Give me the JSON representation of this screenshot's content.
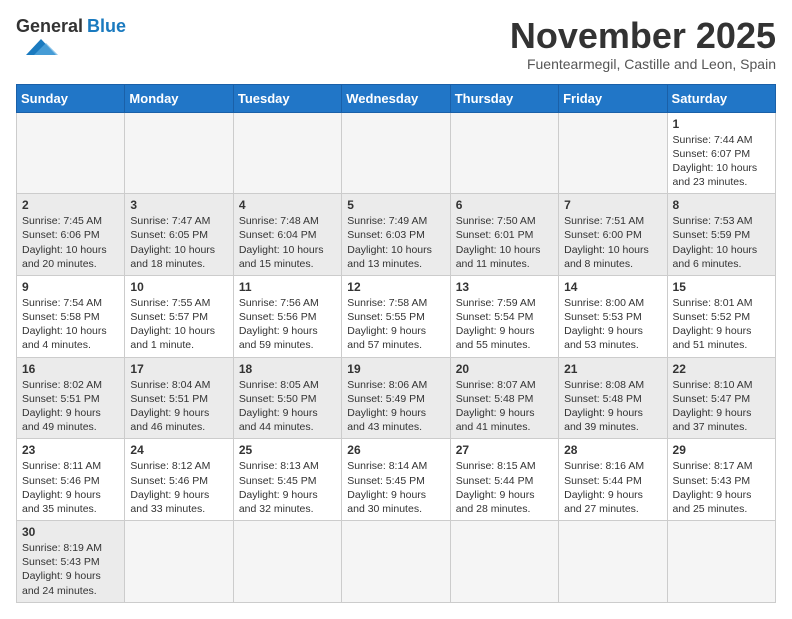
{
  "header": {
    "logo_general": "General",
    "logo_blue": "Blue",
    "month_title": "November 2025",
    "location": "Fuentearmegil, Castille and Leon, Spain"
  },
  "weekdays": [
    "Sunday",
    "Monday",
    "Tuesday",
    "Wednesday",
    "Thursday",
    "Friday",
    "Saturday"
  ],
  "weeks": [
    [
      {
        "day": "",
        "info": ""
      },
      {
        "day": "",
        "info": ""
      },
      {
        "day": "",
        "info": ""
      },
      {
        "day": "",
        "info": ""
      },
      {
        "day": "",
        "info": ""
      },
      {
        "day": "",
        "info": ""
      },
      {
        "day": "1",
        "info": "Sunrise: 7:44 AM\nSunset: 6:07 PM\nDaylight: 10 hours and 23 minutes."
      }
    ],
    [
      {
        "day": "2",
        "info": "Sunrise: 7:45 AM\nSunset: 6:06 PM\nDaylight: 10 hours and 20 minutes."
      },
      {
        "day": "3",
        "info": "Sunrise: 7:47 AM\nSunset: 6:05 PM\nDaylight: 10 hours and 18 minutes."
      },
      {
        "day": "4",
        "info": "Sunrise: 7:48 AM\nSunset: 6:04 PM\nDaylight: 10 hours and 15 minutes."
      },
      {
        "day": "5",
        "info": "Sunrise: 7:49 AM\nSunset: 6:03 PM\nDaylight: 10 hours and 13 minutes."
      },
      {
        "day": "6",
        "info": "Sunrise: 7:50 AM\nSunset: 6:01 PM\nDaylight: 10 hours and 11 minutes."
      },
      {
        "day": "7",
        "info": "Sunrise: 7:51 AM\nSunset: 6:00 PM\nDaylight: 10 hours and 8 minutes."
      },
      {
        "day": "8",
        "info": "Sunrise: 7:53 AM\nSunset: 5:59 PM\nDaylight: 10 hours and 6 minutes."
      }
    ],
    [
      {
        "day": "9",
        "info": "Sunrise: 7:54 AM\nSunset: 5:58 PM\nDaylight: 10 hours and 4 minutes."
      },
      {
        "day": "10",
        "info": "Sunrise: 7:55 AM\nSunset: 5:57 PM\nDaylight: 10 hours and 1 minute."
      },
      {
        "day": "11",
        "info": "Sunrise: 7:56 AM\nSunset: 5:56 PM\nDaylight: 9 hours and 59 minutes."
      },
      {
        "day": "12",
        "info": "Sunrise: 7:58 AM\nSunset: 5:55 PM\nDaylight: 9 hours and 57 minutes."
      },
      {
        "day": "13",
        "info": "Sunrise: 7:59 AM\nSunset: 5:54 PM\nDaylight: 9 hours and 55 minutes."
      },
      {
        "day": "14",
        "info": "Sunrise: 8:00 AM\nSunset: 5:53 PM\nDaylight: 9 hours and 53 minutes."
      },
      {
        "day": "15",
        "info": "Sunrise: 8:01 AM\nSunset: 5:52 PM\nDaylight: 9 hours and 51 minutes."
      }
    ],
    [
      {
        "day": "16",
        "info": "Sunrise: 8:02 AM\nSunset: 5:51 PM\nDaylight: 9 hours and 49 minutes."
      },
      {
        "day": "17",
        "info": "Sunrise: 8:04 AM\nSunset: 5:51 PM\nDaylight: 9 hours and 46 minutes."
      },
      {
        "day": "18",
        "info": "Sunrise: 8:05 AM\nSunset: 5:50 PM\nDaylight: 9 hours and 44 minutes."
      },
      {
        "day": "19",
        "info": "Sunrise: 8:06 AM\nSunset: 5:49 PM\nDaylight: 9 hours and 43 minutes."
      },
      {
        "day": "20",
        "info": "Sunrise: 8:07 AM\nSunset: 5:48 PM\nDaylight: 9 hours and 41 minutes."
      },
      {
        "day": "21",
        "info": "Sunrise: 8:08 AM\nSunset: 5:48 PM\nDaylight: 9 hours and 39 minutes."
      },
      {
        "day": "22",
        "info": "Sunrise: 8:10 AM\nSunset: 5:47 PM\nDaylight: 9 hours and 37 minutes."
      }
    ],
    [
      {
        "day": "23",
        "info": "Sunrise: 8:11 AM\nSunset: 5:46 PM\nDaylight: 9 hours and 35 minutes."
      },
      {
        "day": "24",
        "info": "Sunrise: 8:12 AM\nSunset: 5:46 PM\nDaylight: 9 hours and 33 minutes."
      },
      {
        "day": "25",
        "info": "Sunrise: 8:13 AM\nSunset: 5:45 PM\nDaylight: 9 hours and 32 minutes."
      },
      {
        "day": "26",
        "info": "Sunrise: 8:14 AM\nSunset: 5:45 PM\nDaylight: 9 hours and 30 minutes."
      },
      {
        "day": "27",
        "info": "Sunrise: 8:15 AM\nSunset: 5:44 PM\nDaylight: 9 hours and 28 minutes."
      },
      {
        "day": "28",
        "info": "Sunrise: 8:16 AM\nSunset: 5:44 PM\nDaylight: 9 hours and 27 minutes."
      },
      {
        "day": "29",
        "info": "Sunrise: 8:17 AM\nSunset: 5:43 PM\nDaylight: 9 hours and 25 minutes."
      }
    ],
    [
      {
        "day": "30",
        "info": "Sunrise: 8:19 AM\nSunset: 5:43 PM\nDaylight: 9 hours and 24 minutes."
      },
      {
        "day": "",
        "info": ""
      },
      {
        "day": "",
        "info": ""
      },
      {
        "day": "",
        "info": ""
      },
      {
        "day": "",
        "info": ""
      },
      {
        "day": "",
        "info": ""
      },
      {
        "day": "",
        "info": ""
      }
    ]
  ]
}
